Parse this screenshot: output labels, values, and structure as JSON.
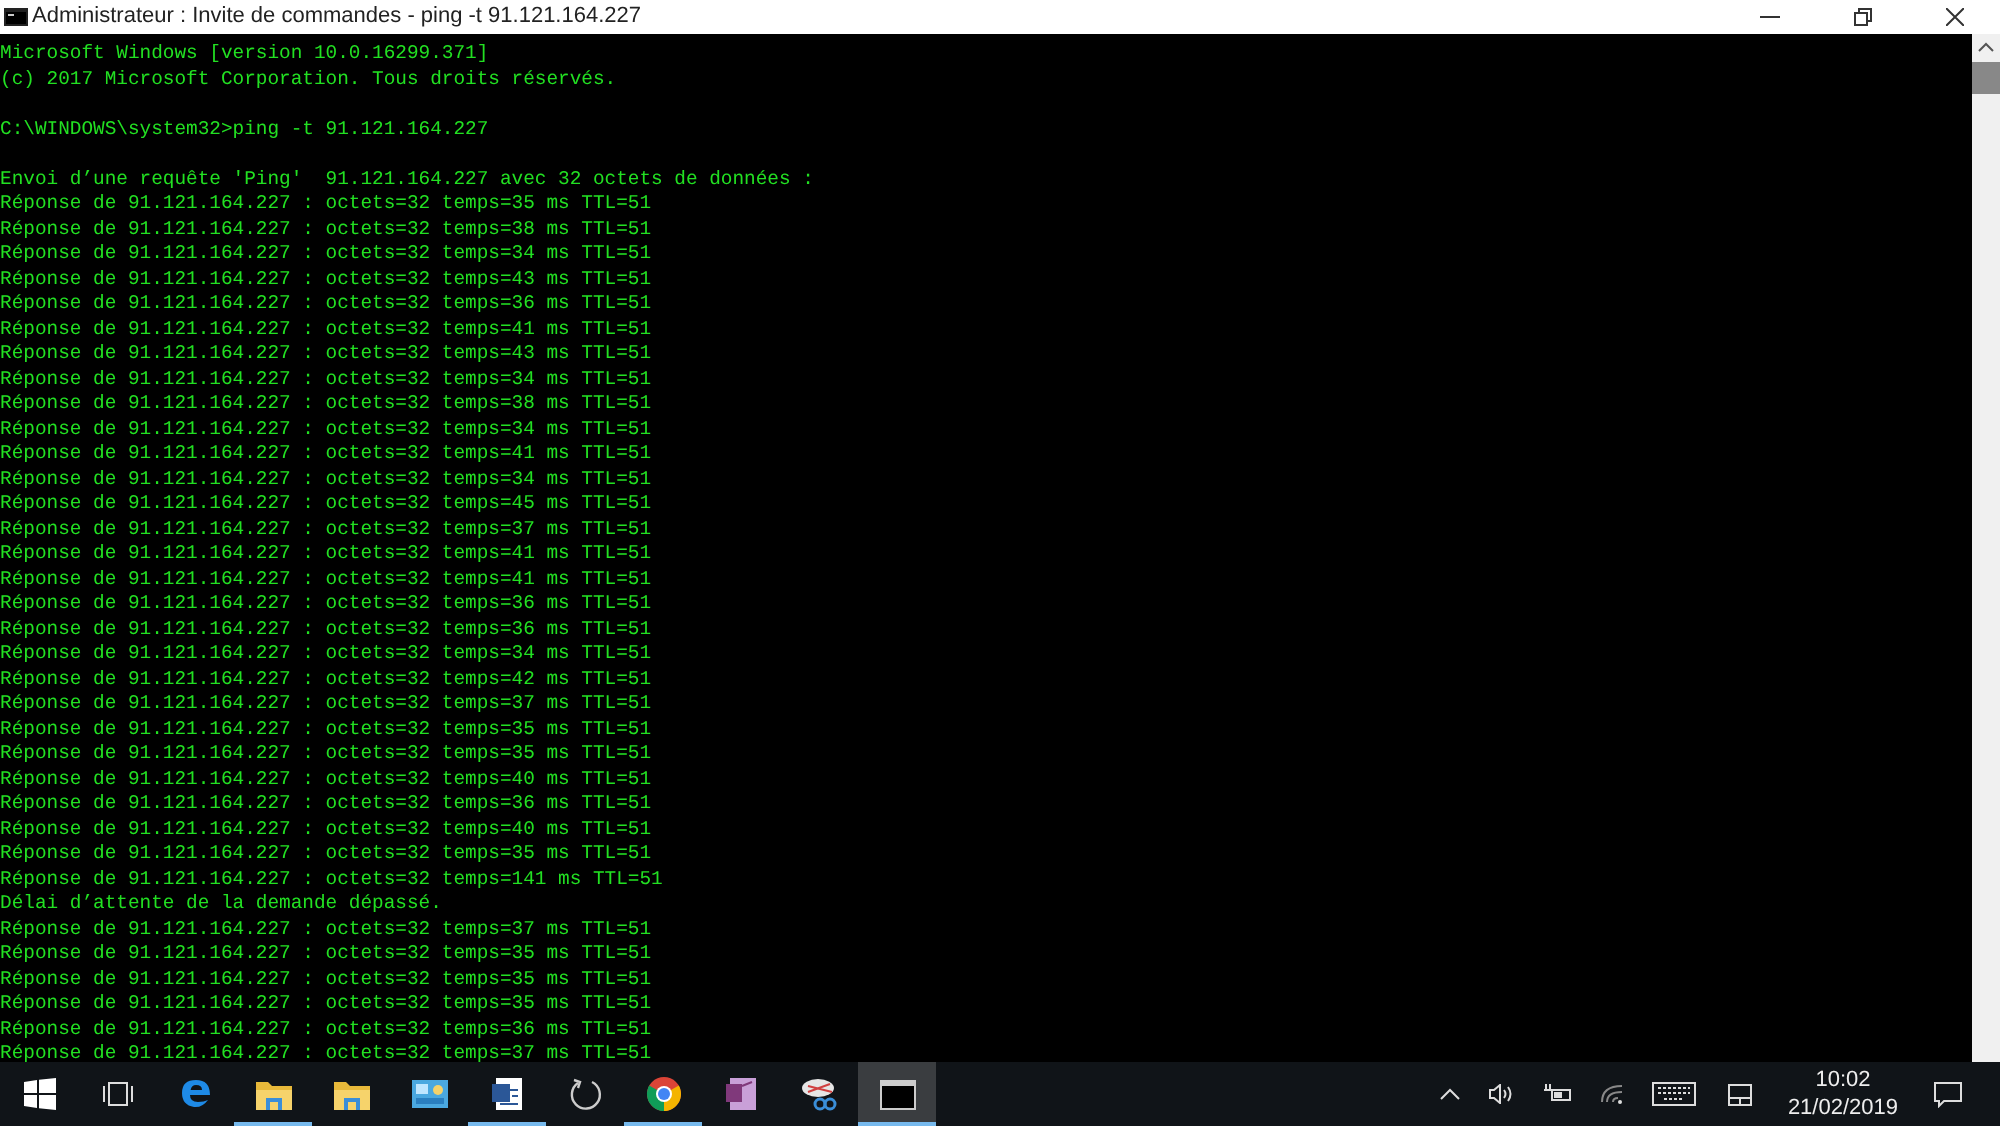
{
  "window": {
    "title": "Administrateur : Invite de commandes - ping  -t 91.121.164.227"
  },
  "console": {
    "blocks": [
      [
        "Microsoft Windows [version 10.0.16299.371]",
        "(c) 2017 Microsoft Corporation. Tous droits réservés."
      ],
      [
        "C:\\WINDOWS\\system32>ping -t 91.121.164.227"
      ],
      [
        "Envoi d’une requête 'Ping'  91.121.164.227 avec 32 octets de données :",
        "Réponse de 91.121.164.227 : octets=32 temps=35 ms TTL=51",
        "Réponse de 91.121.164.227 : octets=32 temps=38 ms TTL=51",
        "Réponse de 91.121.164.227 : octets=32 temps=34 ms TTL=51",
        "Réponse de 91.121.164.227 : octets=32 temps=43 ms TTL=51",
        "Réponse de 91.121.164.227 : octets=32 temps=36 ms TTL=51",
        "Réponse de 91.121.164.227 : octets=32 temps=41 ms TTL=51",
        "Réponse de 91.121.164.227 : octets=32 temps=43 ms TTL=51",
        "Réponse de 91.121.164.227 : octets=32 temps=34 ms TTL=51",
        "Réponse de 91.121.164.227 : octets=32 temps=38 ms TTL=51",
        "Réponse de 91.121.164.227 : octets=32 temps=34 ms TTL=51",
        "Réponse de 91.121.164.227 : octets=32 temps=41 ms TTL=51",
        "Réponse de 91.121.164.227 : octets=32 temps=34 ms TTL=51",
        "Réponse de 91.121.164.227 : octets=32 temps=45 ms TTL=51",
        "Réponse de 91.121.164.227 : octets=32 temps=37 ms TTL=51",
        "Réponse de 91.121.164.227 : octets=32 temps=41 ms TTL=51",
        "Réponse de 91.121.164.227 : octets=32 temps=41 ms TTL=51",
        "Réponse de 91.121.164.227 : octets=32 temps=36 ms TTL=51",
        "Réponse de 91.121.164.227 : octets=32 temps=36 ms TTL=51",
        "Réponse de 91.121.164.227 : octets=32 temps=34 ms TTL=51",
        "Réponse de 91.121.164.227 : octets=32 temps=42 ms TTL=51",
        "Réponse de 91.121.164.227 : octets=32 temps=37 ms TTL=51",
        "Réponse de 91.121.164.227 : octets=32 temps=35 ms TTL=51",
        "Réponse de 91.121.164.227 : octets=32 temps=35 ms TTL=51",
        "Réponse de 91.121.164.227 : octets=32 temps=40 ms TTL=51",
        "Réponse de 91.121.164.227 : octets=32 temps=36 ms TTL=51",
        "Réponse de 91.121.164.227 : octets=32 temps=40 ms TTL=51",
        "Réponse de 91.121.164.227 : octets=32 temps=35 ms TTL=51",
        "Réponse de 91.121.164.227 : octets=32 temps=141 ms TTL=51",
        "Délai d’attente de la demande dépassé.",
        "Réponse de 91.121.164.227 : octets=32 temps=37 ms TTL=51",
        "Réponse de 91.121.164.227 : octets=32 temps=35 ms TTL=51",
        "Réponse de 91.121.164.227 : octets=32 temps=35 ms TTL=51",
        "Réponse de 91.121.164.227 : octets=32 temps=35 ms TTL=51",
        "Réponse de 91.121.164.227 : octets=32 temps=36 ms TTL=51",
        "Réponse de 91.121.164.227 : octets=32 temps=37 ms TTL=51"
      ]
    ]
  },
  "taskbar": {
    "apps": [
      {
        "kind": "start",
        "running": false,
        "selected": false
      },
      {
        "kind": "taskview",
        "running": false,
        "selected": false
      },
      {
        "kind": "edge",
        "running": false,
        "selected": false
      },
      {
        "kind": "folder",
        "running": true,
        "selected": false
      },
      {
        "kind": "folder",
        "running": false,
        "selected": false
      },
      {
        "kind": "panel",
        "running": false,
        "selected": false
      },
      {
        "kind": "document",
        "running": true,
        "selected": false
      },
      {
        "kind": "circle",
        "running": false,
        "selected": false
      },
      {
        "kind": "chrome",
        "running": true,
        "selected": false
      },
      {
        "kind": "notebook",
        "running": false,
        "selected": false
      },
      {
        "kind": "scissors",
        "running": false,
        "selected": false
      },
      {
        "kind": "console",
        "running": true,
        "selected": true
      }
    ],
    "clock": {
      "time": "10:02",
      "date": "21/02/2019"
    }
  }
}
